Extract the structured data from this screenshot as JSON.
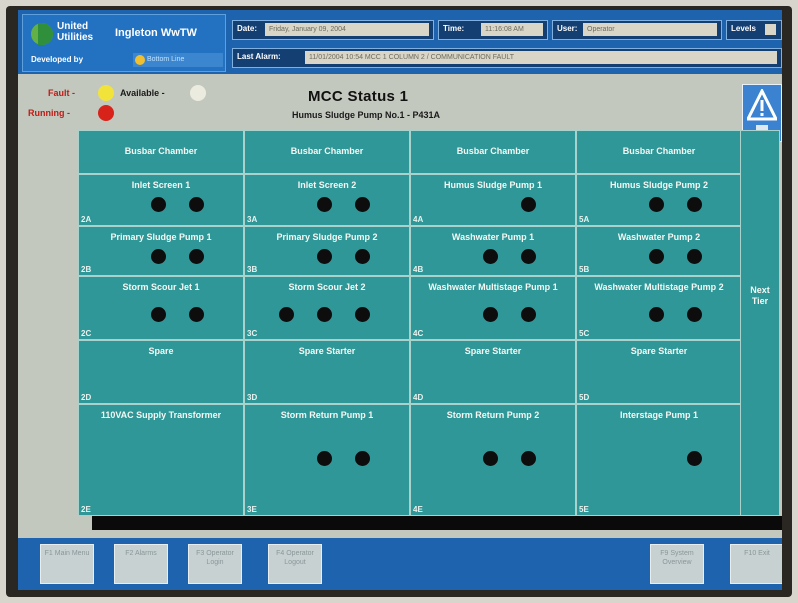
{
  "header": {
    "company_name": "United Utilities",
    "site_name": "Ingleton WwTW",
    "developed_by_label": "Developed by",
    "developer_name": "Bottom Line",
    "date_label": "Date:",
    "date_value": "Friday, January 09, 2004",
    "time_label": "Time:",
    "time_value": "11:16:08 AM",
    "user_label": "User:",
    "user_value": "Operator",
    "levels_label": "Levels",
    "last_alarm_label": "Last Alarm:",
    "last_alarm_value": "11/01/2004 10:54 MCC 1 COLUMN 2 / COMMUNICATION FAULT"
  },
  "legend": {
    "fault_label": "Fault -",
    "available_label": "Available -",
    "running_label": "Running -"
  },
  "page": {
    "title": "MCC Status 1",
    "subtitle": "Humus Sludge Pump No.1 - P431A"
  },
  "colors": {
    "fault": "#f2e33a",
    "available": "#ecebe0",
    "running": "#d8231a",
    "off": "#0d0d0d",
    "cell": "#2f9797",
    "header": "#1e63ad"
  },
  "grid": {
    "busbar_label": "Busbar Chamber",
    "cells": [
      {
        "id": "2A",
        "title": "Inlet Screen 1",
        "lamps": [
          "available",
          "off",
          "off"
        ]
      },
      {
        "id": "3A",
        "title": "Inlet Screen 2",
        "lamps": [
          "available",
          "off",
          "off"
        ]
      },
      {
        "id": "4A",
        "title": "Humus Sludge Pump 1",
        "lamps": [
          "available",
          "running",
          "off"
        ]
      },
      {
        "id": "5A",
        "title": "Humus Sludge Pump 2",
        "lamps": [
          "available",
          "off",
          "off"
        ]
      },
      {
        "id": "2B",
        "title": "Primary Sludge Pump 1",
        "lamps": [
          "available",
          "off",
          "off"
        ]
      },
      {
        "id": "3B",
        "title": "Primary Sludge Pump 2",
        "lamps": [
          "available",
          "off",
          "off"
        ]
      },
      {
        "id": "4B",
        "title": "Washwater Pump 1",
        "lamps": [
          "available",
          "off",
          "off"
        ]
      },
      {
        "id": "5B",
        "title": "Washwater Pump 2",
        "lamps": [
          "available",
          "off",
          "off"
        ]
      },
      {
        "id": "2C",
        "title": "Storm Scour Jet 1",
        "lamps": [
          "available",
          "off",
          "off"
        ]
      },
      {
        "id": "3C",
        "title": "Storm Scour Jet 2",
        "lamps": [
          "off",
          "off",
          "off"
        ]
      },
      {
        "id": "4C",
        "title": "Washwater Multistage Pump 1",
        "lamps": [
          "available",
          "off",
          "off"
        ]
      },
      {
        "id": "5C",
        "title": "Washwater Multistage Pump 2",
        "lamps": [
          "available",
          "off",
          "off"
        ]
      },
      {
        "id": "2D",
        "title": "Spare",
        "lamps": []
      },
      {
        "id": "3D",
        "title": "Spare Starter",
        "lamps": []
      },
      {
        "id": "4D",
        "title": "Spare Starter",
        "lamps": []
      },
      {
        "id": "5D",
        "title": "Spare Starter",
        "lamps": []
      },
      {
        "id": "2E",
        "title": "110VAC Supply Transformer",
        "lamps": []
      },
      {
        "id": "3E",
        "title": "Storm Return Pump 1",
        "lamps": [
          "available",
          "off",
          "off"
        ]
      },
      {
        "id": "4E",
        "title": "Storm Return Pump 2",
        "lamps": [
          "available",
          "off",
          "off"
        ]
      },
      {
        "id": "5E",
        "title": "Interstage Pump 1",
        "lamps": [
          "available",
          "running",
          "off"
        ]
      }
    ]
  },
  "next_tier_label": "Next Tier",
  "footer": {
    "keys": [
      {
        "label": "F1 Main Menu"
      },
      {
        "label": "F2 Alarms"
      },
      {
        "label": "F3 Operator Login"
      },
      {
        "label": "F4 Operator Logout"
      },
      {
        "label": "F9 System Overview"
      },
      {
        "label": "F10 Exit"
      }
    ]
  }
}
